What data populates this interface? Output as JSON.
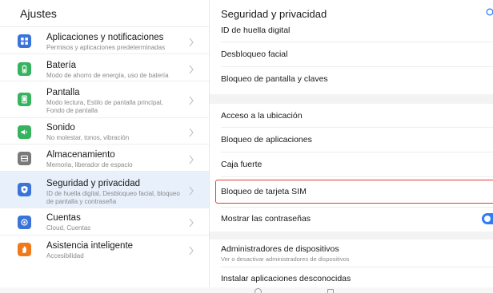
{
  "left": {
    "title": "Ajustes",
    "items": [
      {
        "title": "Aplicaciones y notificaciones",
        "subtitle": "Permisos y aplicaciones predeterminadas",
        "icon": "apps-icon",
        "color": "#3b73d9"
      },
      {
        "title": "Batería",
        "subtitle": "Modo de ahorro de energía, uso de batería",
        "icon": "battery-icon",
        "color": "#35b35f"
      },
      {
        "title": "Pantalla",
        "subtitle": "Modo lectura, Estilo de pantalla principal,",
        "subtitle2": "Fondo de pantalla",
        "icon": "display-icon",
        "color": "#35b35f"
      },
      {
        "title": "Sonido",
        "subtitle": "No molestar, tonos, vibración",
        "icon": "sound-icon",
        "color": "#35b35f"
      },
      {
        "title": "Almacenamiento",
        "subtitle": "Memoria, liberador de espacio",
        "icon": "storage-icon",
        "color": "#7a7a7a"
      },
      {
        "title": "Seguridad y privacidad",
        "subtitle": "ID de huella digital, Desbloqueo facial, bloqueo",
        "subtitle2": "de pantalla y contraseña",
        "icon": "shield-icon",
        "color": "#3b73d9"
      },
      {
        "title": "Cuentas",
        "subtitle": "Cloud, Cuentas",
        "icon": "account-icon",
        "color": "#3b73d9"
      },
      {
        "title": "Asistencia inteligente",
        "subtitle": "Accesibilidad",
        "icon": "hand-icon",
        "color": "#f07a1a"
      }
    ]
  },
  "right": {
    "title": "Seguridad y privacidad",
    "items": {
      "fingerprint": "ID de huella digital",
      "face_unlock": "Desbloqueo facial",
      "screen_lock": "Bloqueo de pantalla y claves",
      "location": "Acceso a la ubicación",
      "app_lock": "Bloqueo de aplicaciones",
      "safe": "Caja fuerte",
      "sim_lock": "Bloqueo de tarjeta SIM",
      "show_passwords": "Mostrar las contraseñas",
      "device_admins": "Administradores de dispositivos",
      "device_admins_sub": "Ver o desactivar administradores de dispositivos",
      "unknown_apps": "Instalar aplicaciones desconocidas"
    },
    "show_passwords_enabled": true
  },
  "colors": {
    "accent": "#2f7df6",
    "highlight": "#e53935",
    "selected_bg": "#e7f0fb"
  }
}
